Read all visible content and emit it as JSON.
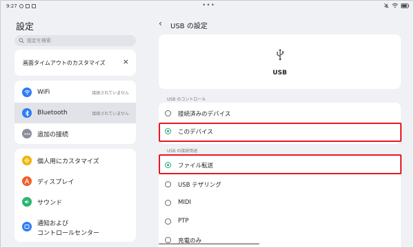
{
  "statusbar": {
    "time": "9:27",
    "center_dots": "•••"
  },
  "left": {
    "title": "設定",
    "search_placeholder": "設定を検索",
    "banner": {
      "text": "画面タイムアウトのカスタマイズ",
      "close": "×"
    },
    "group1": [
      {
        "label": "WiFi",
        "status": "接続されていません",
        "icon": "wifi-icon",
        "color": "#2f7cf6",
        "glyph": "≋"
      },
      {
        "label": "Bluetooth",
        "status": "接続されていません",
        "icon": "bluetooth-icon",
        "color": "#2f7cf6",
        "glyph": "ᛒ"
      },
      {
        "label": "追加の接続",
        "status": "",
        "icon": "more-connections-icon",
        "color": "#8a8f99",
        "glyph": "⋯"
      }
    ],
    "group2": [
      {
        "label": "個人用にカスタマイズ",
        "icon": "personalize-icon",
        "color": "#f0b400",
        "glyph": "◈"
      },
      {
        "label": "ディスプレイ",
        "icon": "display-icon",
        "color": "#f0602a",
        "glyph": "A"
      },
      {
        "label": "サウンド",
        "icon": "sound-icon",
        "color": "#2bb673",
        "glyph": "◁"
      },
      {
        "label": "通知および",
        "label2": "コントロールセンター",
        "icon": "notification-icon",
        "color": "#2f7cf6",
        "glyph": "▭"
      }
    ]
  },
  "right": {
    "back": "‹",
    "title": "USB の設定",
    "usb_label": "USB",
    "section1": "USB のコントロール",
    "control_options": [
      "接続済みのデバイス",
      "このデバイス"
    ],
    "control_selected": 1,
    "section2": "USB の接続用途",
    "usage_options": [
      "ファイル転送",
      "USB テザリング",
      "MIDI",
      "PTP",
      "充電のみ"
    ],
    "usage_selected": 0
  },
  "colors": {
    "accent": "#1aa37a",
    "highlight": "#e8161f",
    "background": "#f0f1f5"
  }
}
